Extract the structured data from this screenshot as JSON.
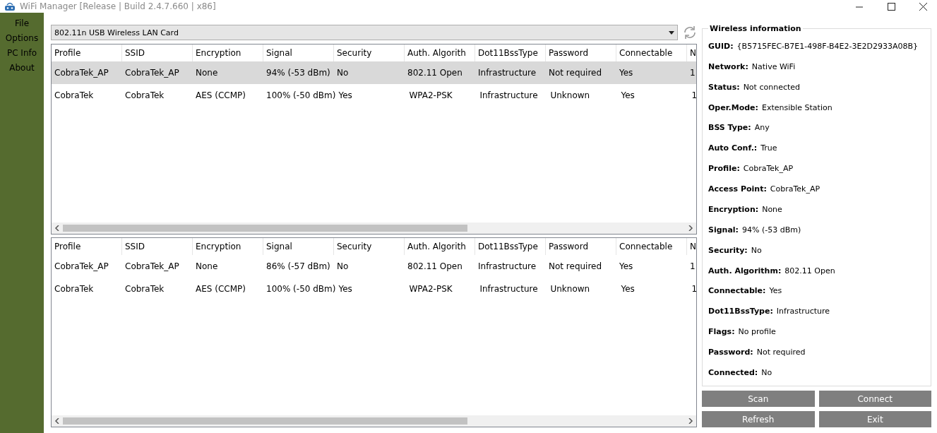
{
  "window": {
    "title": "WiFi Manager [Release | Build 2.4.7.660 | x86]"
  },
  "menu": [
    "File",
    "Options",
    "PC Info",
    "About"
  ],
  "adapter": {
    "value": "802.11n USB Wireless LAN Card"
  },
  "profiles_table": {
    "columns": [
      "Profile",
      "SSID",
      "Encryption",
      "Signal",
      "Security",
      "Auth. Algorith",
      "Dot11BssType",
      "Password",
      "Connectable",
      "N"
    ],
    "rows": [
      {
        "selected": true,
        "cells": [
          "CobraTek_AP",
          "CobraTek_AP",
          "None",
          "94% (-53 dBm)",
          "No",
          "802.11 Open",
          "Infrastructure",
          "Not required",
          "Yes",
          "1"
        ]
      },
      {
        "selected": false,
        "cells": [
          "CobraTek",
          "CobraTek",
          "AES (CCMP)",
          "100% (-50 dBm)",
          "Yes",
          "WPA2-PSK",
          "Infrastructure",
          "Unknown",
          "Yes",
          "1"
        ]
      }
    ]
  },
  "networks_table": {
    "columns": [
      "Profile",
      "SSID",
      "Encryption",
      "Signal",
      "Security",
      "Auth. Algorith",
      "Dot11BssType",
      "Password",
      "Connectable",
      "N"
    ],
    "rows": [
      {
        "selected": false,
        "cells": [
          "CobraTek_AP",
          "CobraTek_AP",
          "None",
          "86% (-57 dBm)",
          "No",
          "802.11 Open",
          "Infrastructure",
          "Not required",
          "Yes",
          "1"
        ]
      },
      {
        "selected": false,
        "cells": [
          "CobraTek",
          "CobraTek",
          "AES (CCMP)",
          "100% (-50 dBm)",
          "Yes",
          "WPA2-PSK",
          "Infrastructure",
          "Unknown",
          "Yes",
          "1"
        ]
      }
    ]
  },
  "wireless_information": {
    "title": "Wireless information",
    "fields": [
      {
        "label": "GUID:",
        "value": "{B5715FEC-B7E1-498F-B4E2-3E2D2933A08B}"
      },
      {
        "label": "Network:",
        "value": "Native WiFi"
      },
      {
        "label": "Status:",
        "value": "Not connected"
      },
      {
        "label": "Oper.Mode:",
        "value": "Extensible Station"
      },
      {
        "label": "BSS Type:",
        "value": "Any"
      },
      {
        "label": "Auto Conf.:",
        "value": "True"
      },
      {
        "label": "Profile:",
        "value": "CobraTek_AP"
      },
      {
        "label": "Access Point:",
        "value": "CobraTek_AP"
      },
      {
        "label": "Encryption:",
        "value": "None"
      },
      {
        "label": "Signal:",
        "value": "94% (-53 dBm)"
      },
      {
        "label": "Security:",
        "value": "No"
      },
      {
        "label": "Auth. Algorithm:",
        "value": "802.11 Open"
      },
      {
        "label": "Connectable:",
        "value": "Yes"
      },
      {
        "label": "Dot11BssType:",
        "value": "Infrastructure"
      },
      {
        "label": "Flags:",
        "value": "No profile"
      },
      {
        "label": "Password:",
        "value": "Not required"
      },
      {
        "label": "Connected:",
        "value": "No"
      }
    ]
  },
  "buttons": [
    "Scan",
    "Connect",
    "Refresh",
    "Exit"
  ]
}
